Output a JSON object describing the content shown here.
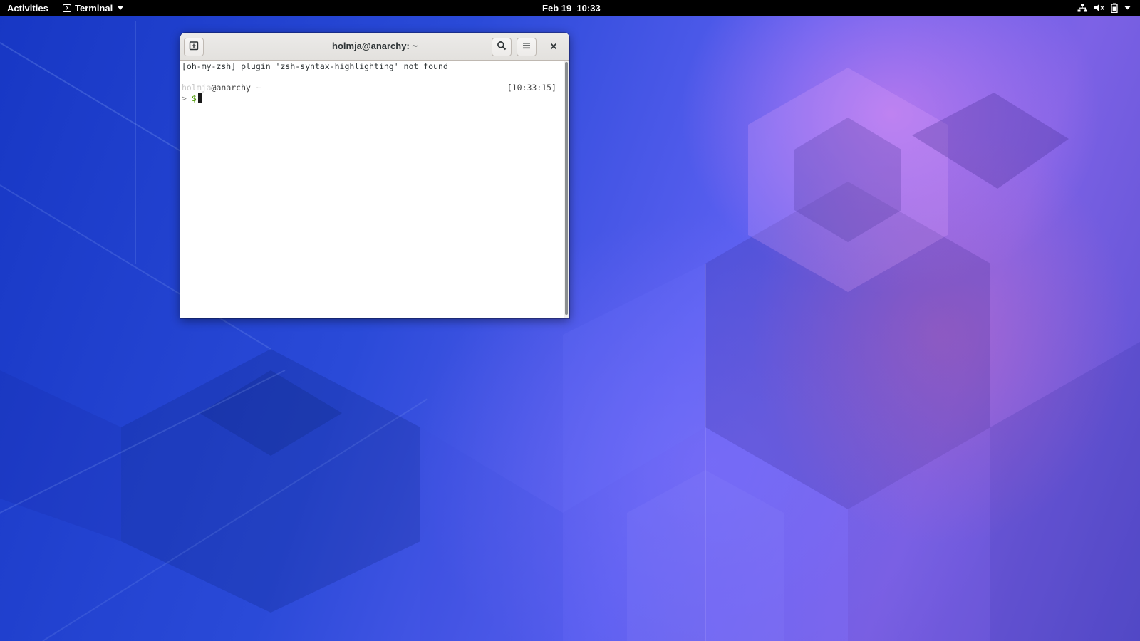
{
  "topbar": {
    "activities_label": "Activities",
    "app_name": "Terminal",
    "date": "Feb 19",
    "time": "10:33",
    "tray_icons": [
      "network-wired-icon",
      "audio-muted-icon",
      "battery-icon",
      "system-menu-caret-icon"
    ]
  },
  "window": {
    "title": "holmja@anarchy: ~",
    "buttons": [
      "new-tab-icon",
      "search-icon",
      "hamburger-menu-icon",
      "close-icon"
    ]
  },
  "terminal": {
    "line1": "[oh-my-zsh] plugin 'zsh-syntax-highlighting' not found",
    "prompt_user": "holmja",
    "prompt_host": "@anarchy",
    "prompt_dir": " ~",
    "timestamp": "[10:33:15]",
    "prompt_arrow": ">",
    "prompt_symbol": "$"
  },
  "colors": {
    "topbar_bg": "#000000",
    "wallpaper_left": "#1737c4",
    "wallpaper_right": "#7d62e6",
    "wallpaper_highlight": "#f08cf0",
    "prompt_dollar": "#4e9a06",
    "terminal_bg": "#ffffff"
  }
}
